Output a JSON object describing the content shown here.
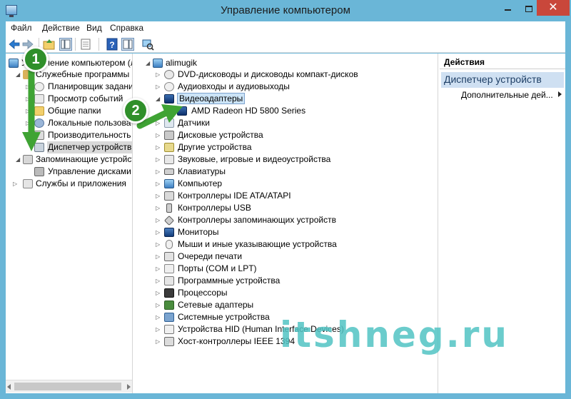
{
  "window": {
    "title": "Управление компьютером",
    "controls": {
      "minimize": "",
      "maximize": "",
      "close": "✕"
    }
  },
  "menu": [
    "Файл",
    "Действие",
    "Вид",
    "Справка"
  ],
  "left_tree": {
    "root": "Управление компьютером (л",
    "items": [
      {
        "label": "Служебные программы",
        "expanded": true
      },
      {
        "label": "Планировщик заданий"
      },
      {
        "label": "Просмотр событий"
      },
      {
        "label": "Общие папки"
      },
      {
        "label": "Локальные пользовате"
      },
      {
        "label": "Производительность"
      },
      {
        "label": "Диспетчер устройств",
        "selected": true
      },
      {
        "label": "Запоминающие устройст",
        "expanded": true
      },
      {
        "label": "Управление дисками"
      },
      {
        "label": "Службы и приложения"
      }
    ]
  },
  "device_tree": {
    "root": "alimugik",
    "expanded_category": "Видеоадаптеры",
    "expanded_child": "AMD Radeon HD 5800 Series",
    "categories": [
      "DVD-дисководы и дисководы компакт-дисков",
      "Аудиовходы и аудиовыходы",
      "Видеоадаптеры",
      "Датчики",
      "Дисковые устройства",
      "Другие устройства",
      "Звуковые, игровые и видеоустройства",
      "Клавиатуры",
      "Компьютер",
      "Контроллеры IDE ATA/ATAPI",
      "Контроллеры USB",
      "Контроллеры запоминающих устройств",
      "Мониторы",
      "Мыши и иные указывающие устройства",
      "Очереди печати",
      "Порты (COM и LPT)",
      "Программные устройства",
      "Процессоры",
      "Сетевые адаптеры",
      "Системные устройства",
      "Устройства HID (Human Interface Devices)",
      "Хост-контроллеры IEEE 1394"
    ]
  },
  "actions": {
    "header": "Действия",
    "section": "Диспетчер устройств",
    "more": "Дополнительные дей..."
  },
  "annotations": {
    "step1": "1",
    "step2": "2",
    "color": "#2f8f2a"
  },
  "watermark": "itshneg.ru",
  "colors": {
    "title_bar": "#6ab6d7",
    "close_button": "#c9473b",
    "selection": "#cce4f7",
    "action_section": "#cfe0f2"
  }
}
